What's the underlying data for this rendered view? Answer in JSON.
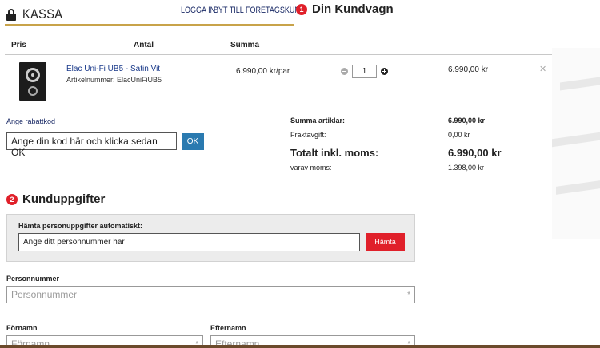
{
  "header": {
    "title": "KASSA",
    "login_link": "LOGGA IN",
    "business_link": "BYT TILL FÖRETAGSKUND",
    "cart_step": "1",
    "cart_title": "Din Kundvagn"
  },
  "cart": {
    "columns": [
      "Pris",
      "Antal",
      "Summa"
    ],
    "item": {
      "name": "Elac Uni-Fi UB5 - Satin Vit",
      "article": "Artikelnummer: ElacUniFiUB5",
      "price": "6.990,00 kr/par",
      "quantity": "1",
      "total": "6.990,00 kr",
      "remove": "✕"
    }
  },
  "discount": {
    "link": "Ange rabattkod",
    "input_value": "Ange din kod här och klicka sedan OK",
    "ok_label": "OK"
  },
  "summary": {
    "articles_label": "Summa artiklar:",
    "articles_value": "6.990,00 kr",
    "shipping_label": "Fraktavgift:",
    "shipping_value": "0,00 kr",
    "total_label": "Totalt inkl. moms:",
    "total_value": "6.990,00 kr",
    "vat_label": "varav moms:",
    "vat_value": "1.398,00 kr"
  },
  "customer": {
    "step": "2",
    "title": "Kunduppgifter",
    "auto_label": "Hämta personuppgifter automatiskt:",
    "auto_input_value": "Ange ditt personnummer här",
    "fetch_label": "Hämta",
    "personnummer_label": "Personnummer",
    "personnummer_placeholder": "Personnummer",
    "fornamn_label": "Förnamn",
    "fornamn_placeholder": "Förnamn",
    "efternamn_label": "Efternamn",
    "efternamn_placeholder": "Efternamn",
    "required_mark": "*"
  },
  "colors": {
    "accent_red": "#e0202a",
    "link_blue": "#1a2a66",
    "ok_blue": "#2a7ab0",
    "gold_underline": "#c8a34a"
  }
}
